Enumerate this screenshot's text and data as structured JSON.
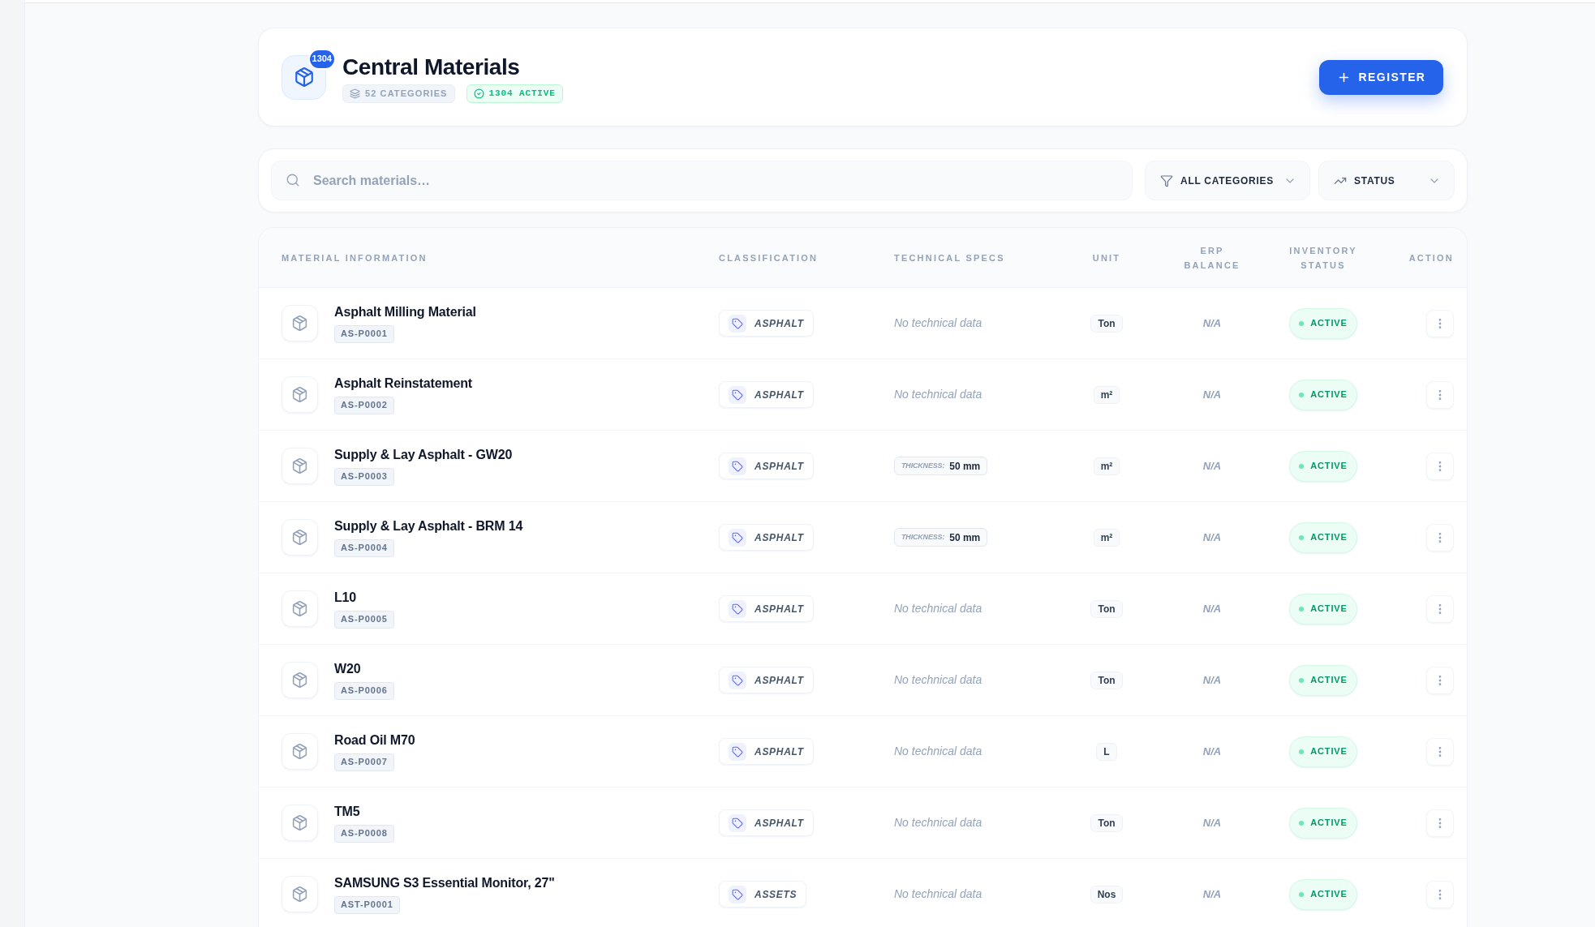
{
  "header": {
    "title": "Central Materials",
    "badge": "1304",
    "chips": [
      {
        "kind": "categories",
        "text": "52 CATEGORIES"
      },
      {
        "kind": "active",
        "text": "1304 ACTIVE"
      }
    ],
    "register_button": "REGISTER"
  },
  "filters": {
    "search": {
      "placeholder": "Search materials…"
    },
    "dropdowns": [
      {
        "kind": "category",
        "label": "ALL CATEGORIES"
      },
      {
        "kind": "status",
        "label": "STATUS"
      }
    ]
  },
  "table": {
    "columns": [
      "MATERIAL INFORMATION",
      "CLASSIFICATION",
      "TECHNICAL SPECS",
      "UNIT",
      "ERP BALANCE",
      "INVENTORY STATUS",
      "ACTION"
    ],
    "rows": [
      {
        "name": "Asphalt Milling Material",
        "code": "AS-P0001",
        "category": "ASPHALT",
        "specs": {
          "kind": "none",
          "text": "No technical data"
        },
        "unit": "Ton",
        "erp_balance": "N/A",
        "status": "ACTIVE"
      },
      {
        "name": "Asphalt Reinstatement",
        "code": "AS-P0002",
        "category": "ASPHALT",
        "specs": {
          "kind": "none",
          "text": "No technical data"
        },
        "unit": "m²",
        "erp_balance": "N/A",
        "status": "ACTIVE"
      },
      {
        "name": "Supply & Lay Asphalt - GW20",
        "code": "AS-P0003",
        "category": "ASPHALT",
        "specs": {
          "kind": "spec",
          "label": "THICKNESS:",
          "value": "50 mm"
        },
        "unit": "m²",
        "erp_balance": "N/A",
        "status": "ACTIVE"
      },
      {
        "name": "Supply & Lay Asphalt - BRM 14",
        "code": "AS-P0004",
        "category": "ASPHALT",
        "specs": {
          "kind": "spec",
          "label": "THICKNESS:",
          "value": "50 mm"
        },
        "unit": "m²",
        "erp_balance": "N/A",
        "status": "ACTIVE"
      },
      {
        "name": "L10",
        "code": "AS-P0005",
        "category": "ASPHALT",
        "specs": {
          "kind": "none",
          "text": "No technical data"
        },
        "unit": "Ton",
        "erp_balance": "N/A",
        "status": "ACTIVE"
      },
      {
        "name": "W20",
        "code": "AS-P0006",
        "category": "ASPHALT",
        "specs": {
          "kind": "none",
          "text": "No technical data"
        },
        "unit": "Ton",
        "erp_balance": "N/A",
        "status": "ACTIVE"
      },
      {
        "name": "Road Oil M70",
        "code": "AS-P0007",
        "category": "ASPHALT",
        "specs": {
          "kind": "none",
          "text": "No technical data"
        },
        "unit": "L",
        "erp_balance": "N/A",
        "status": "ACTIVE"
      },
      {
        "name": "TM5",
        "code": "AS-P0008",
        "category": "ASPHALT",
        "specs": {
          "kind": "none",
          "text": "No technical data"
        },
        "unit": "Ton",
        "erp_balance": "N/A",
        "status": "ACTIVE"
      },
      {
        "name": "SAMSUNG S3 Essential Monitor, 27\"",
        "code": "AST-P0001",
        "category": "ASSETS",
        "specs": {
          "kind": "none",
          "text": "No technical data"
        },
        "unit": "Nos",
        "erp_balance": "N/A",
        "status": "ACTIVE"
      }
    ]
  }
}
